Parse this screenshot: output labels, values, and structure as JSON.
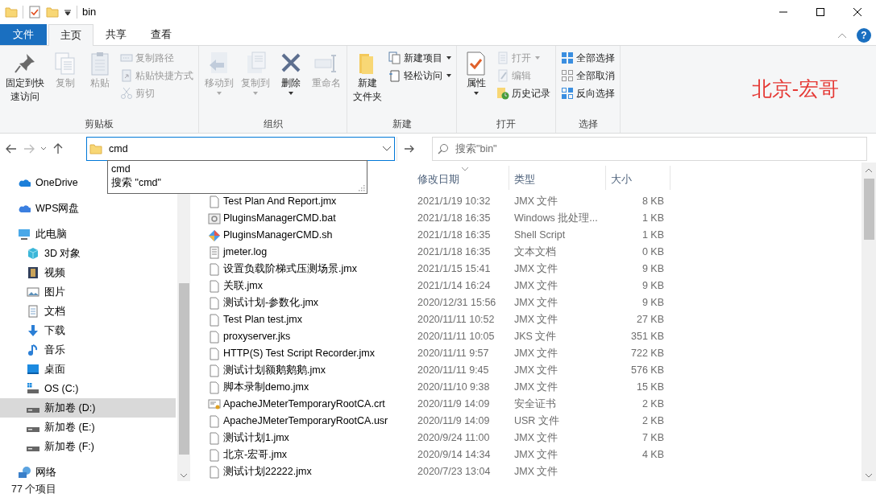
{
  "window": {
    "title": "bin"
  },
  "ribbon_tabs": [
    {
      "label": "文件",
      "kind": "file",
      "selected": false
    },
    {
      "label": "主页",
      "kind": "tab",
      "selected": true
    },
    {
      "label": "共享",
      "kind": "tab",
      "selected": false
    },
    {
      "label": "查看",
      "kind": "tab",
      "selected": false
    }
  ],
  "ribbon_groups": [
    {
      "label": "剪贴板",
      "items": [
        {
          "lines": [
            "固定到快",
            "速访问"
          ],
          "kind": "large",
          "disabled": false,
          "dropdown": false
        },
        {
          "lines": [
            "复制"
          ],
          "kind": "large",
          "disabled": true,
          "dropdown": false
        },
        {
          "lines": [
            "粘贴"
          ],
          "kind": "large",
          "disabled": true,
          "dropdown": false
        },
        {
          "label": "复制路径",
          "kind": "small",
          "disabled": true,
          "dropdown": false
        },
        {
          "label": "粘贴快捷方式",
          "kind": "small",
          "disabled": true,
          "dropdown": false
        },
        {
          "label": "剪切",
          "kind": "small",
          "disabled": true,
          "dropdown": false
        }
      ]
    },
    {
      "label": "组织",
      "items": [
        {
          "lines": [
            "移动到"
          ],
          "kind": "large",
          "disabled": true,
          "dropdown": true
        },
        {
          "lines": [
            "复制到"
          ],
          "kind": "large",
          "disabled": true,
          "dropdown": true
        },
        {
          "lines": [
            "删除"
          ],
          "kind": "large",
          "disabled": false,
          "dropdown": true
        },
        {
          "lines": [
            "重命名"
          ],
          "kind": "large",
          "disabled": true,
          "dropdown": false
        }
      ]
    },
    {
      "label": "新建",
      "items": [
        {
          "lines": [
            "新建",
            "文件夹"
          ],
          "kind": "large",
          "disabled": false,
          "dropdown": false
        },
        {
          "label": "新建项目",
          "kind": "small",
          "disabled": false,
          "dropdown": true
        },
        {
          "label": "轻松访问",
          "kind": "small",
          "disabled": false,
          "dropdown": true
        }
      ]
    },
    {
      "label": "打开",
      "items": [
        {
          "lines": [
            "属性"
          ],
          "kind": "large",
          "disabled": false,
          "dropdown": true
        },
        {
          "label": "打开",
          "kind": "small",
          "disabled": true,
          "dropdown": true
        },
        {
          "label": "编辑",
          "kind": "small",
          "disabled": true,
          "dropdown": false
        },
        {
          "label": "历史记录",
          "kind": "small",
          "disabled": false,
          "dropdown": false
        }
      ]
    },
    {
      "label": "选择",
      "items": [
        {
          "label": "全部选择",
          "kind": "small",
          "disabled": false,
          "dropdown": false
        },
        {
          "label": "全部取消",
          "kind": "small",
          "disabled": false,
          "dropdown": false
        },
        {
          "label": "反向选择",
          "kind": "small",
          "disabled": false,
          "dropdown": false
        }
      ]
    }
  ],
  "help_button": "?",
  "ribbon_note": "北京-宏哥",
  "address_bar": {
    "value": "cmd",
    "suggestions": [
      "cmd",
      "搜索 \"cmd\""
    ]
  },
  "search": {
    "placeholder": "搜索\"bin\""
  },
  "nav": [
    {
      "label": "OneDrive",
      "selected": false
    },
    {
      "label": "WPS网盘",
      "selected": false
    },
    {
      "label": "此电脑",
      "selected": false,
      "children": [
        {
          "label": "3D 对象",
          "selected": false
        },
        {
          "label": "视频",
          "selected": false
        },
        {
          "label": "图片",
          "selected": false
        },
        {
          "label": "文档",
          "selected": false
        },
        {
          "label": "下载",
          "selected": false
        },
        {
          "label": "音乐",
          "selected": false
        },
        {
          "label": "桌面",
          "selected": false
        },
        {
          "label": "OS (C:)",
          "selected": false
        },
        {
          "label": "新加卷 (D:)",
          "selected": true
        },
        {
          "label": "新加卷 (E:)",
          "selected": false
        },
        {
          "label": "新加卷 (F:)",
          "selected": false
        }
      ]
    },
    {
      "label": "网络",
      "selected": false
    }
  ],
  "columns": [
    {
      "label": "修改日期",
      "sorted": true
    },
    {
      "label": "类型",
      "sorted": false
    },
    {
      "label": "大小",
      "sorted": false
    }
  ],
  "files": [
    {
      "name": "Test Plan And Report.jmx",
      "date": "2021/1/19 10:32",
      "type": "JMX 文件",
      "size": "8 KB",
      "kind": "file"
    },
    {
      "name": "PluginsManagerCMD.bat",
      "date": "2021/1/18 16:35",
      "type": "Windows 批处理...",
      "size": "1 KB",
      "kind": "batch"
    },
    {
      "name": "PluginsManagerCMD.sh",
      "date": "2021/1/18 16:35",
      "type": "Shell Script",
      "size": "1 KB",
      "kind": "shell"
    },
    {
      "name": "jmeter.log",
      "date": "2021/1/18 16:35",
      "type": "文本文档",
      "size": "0 KB",
      "kind": "text"
    },
    {
      "name": "设置负载阶梯式压测场景.jmx",
      "date": "2021/1/15 15:41",
      "type": "JMX 文件",
      "size": "9 KB",
      "kind": "file"
    },
    {
      "name": "关联.jmx",
      "date": "2021/1/14 16:24",
      "type": "JMX 文件",
      "size": "9 KB",
      "kind": "file"
    },
    {
      "name": "测试计划-参数化.jmx",
      "date": "2020/12/31 15:56",
      "type": "JMX 文件",
      "size": "9 KB",
      "kind": "file"
    },
    {
      "name": "Test Plan test.jmx",
      "date": "2020/11/11 10:52",
      "type": "JMX 文件",
      "size": "27 KB",
      "kind": "file"
    },
    {
      "name": "proxyserver.jks",
      "date": "2020/11/11 10:05",
      "type": "JKS 文件",
      "size": "351 KB",
      "kind": "file"
    },
    {
      "name": "HTTP(S) Test Script Recorder.jmx",
      "date": "2020/11/11 9:57",
      "type": "JMX 文件",
      "size": "722 KB",
      "kind": "file"
    },
    {
      "name": "测试计划额鹅鹅鹅.jmx",
      "date": "2020/11/11 9:45",
      "type": "JMX 文件",
      "size": "576 KB",
      "kind": "file"
    },
    {
      "name": "脚本录制demo.jmx",
      "date": "2020/11/10 9:38",
      "type": "JMX 文件",
      "size": "15 KB",
      "kind": "file"
    },
    {
      "name": "ApacheJMeterTemporaryRootCA.crt",
      "date": "2020/11/9 14:09",
      "type": "安全证书",
      "size": "2 KB",
      "kind": "certificate"
    },
    {
      "name": "ApacheJMeterTemporaryRootCA.usr",
      "date": "2020/11/9 14:09",
      "type": "USR 文件",
      "size": "2 KB",
      "kind": "file"
    },
    {
      "name": "测试计划1.jmx",
      "date": "2020/9/24 11:00",
      "type": "JMX 文件",
      "size": "7 KB",
      "kind": "file"
    },
    {
      "name": "北京-宏哥.jmx",
      "date": "2020/9/14 14:34",
      "type": "JMX 文件",
      "size": "4 KB",
      "kind": "file"
    },
    {
      "name": "测试计划22222.jmx",
      "date": "2020/7/23 13:04",
      "type": "JMX 文件",
      "kind": "file"
    }
  ],
  "status_bar": {
    "text": "77 个项目"
  }
}
